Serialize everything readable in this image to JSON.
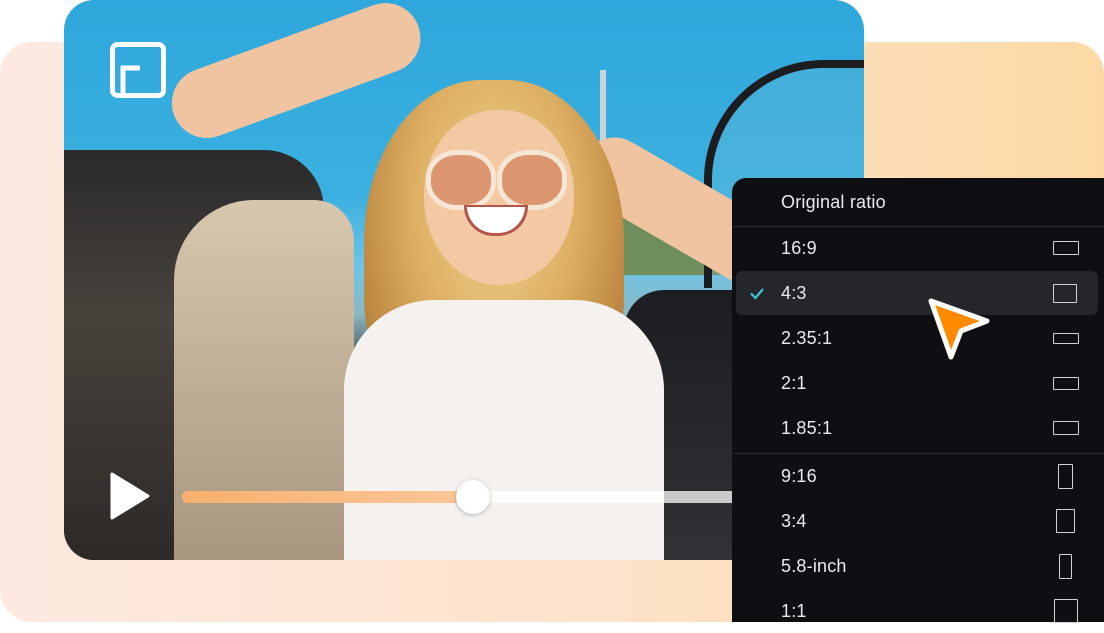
{
  "player": {
    "progress_percent": 52,
    "accent_color": "#f7b06d",
    "fullscreen_icon": "aspect-ratio-icon",
    "play_icon": "play-icon"
  },
  "ratio_menu": {
    "header": "Original ratio",
    "selected": "4:3",
    "check_color": "#3ec7d6",
    "groups": [
      [
        {
          "label": "16:9",
          "shape": "landscape-wide"
        },
        {
          "label": "4:3",
          "shape": "landscape"
        },
        {
          "label": "2.35:1",
          "shape": "landscape-ultrawide"
        },
        {
          "label": "2:1",
          "shape": "landscape-wide"
        },
        {
          "label": "1.85:1",
          "shape": "landscape-wide"
        }
      ],
      [
        {
          "label": "9:16",
          "shape": "portrait-tall"
        },
        {
          "label": "3:4",
          "shape": "portrait"
        },
        {
          "label": "5.8-inch",
          "shape": "portrait-narrow"
        },
        {
          "label": "1:1",
          "shape": "square"
        }
      ]
    ]
  },
  "pointer": {
    "icon": "cursor-arrow-icon",
    "color": "#ff8a00"
  }
}
